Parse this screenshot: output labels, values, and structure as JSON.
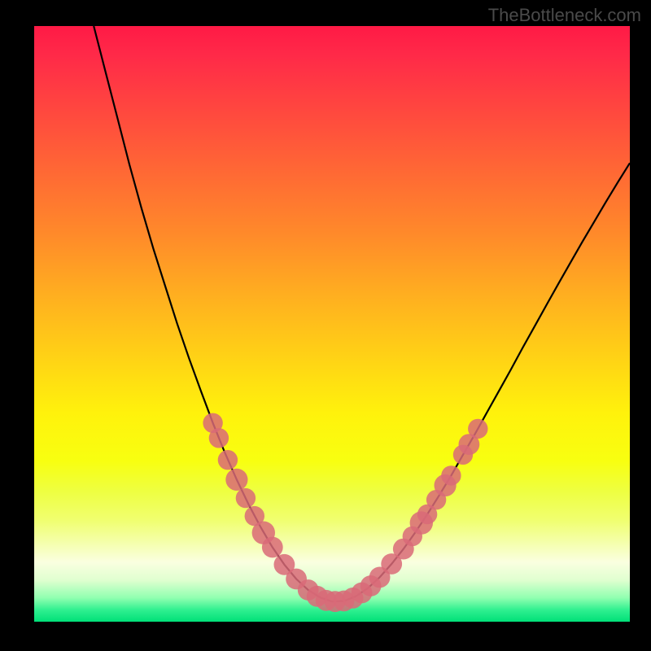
{
  "watermark": "TheBottleneck.com",
  "colors": {
    "background": "#000000",
    "curve": "#000000",
    "marker": "#d96a78",
    "gradient_top": "#ff1a46",
    "gradient_bottom": "#00e078"
  },
  "chart_data": {
    "type": "line",
    "title": "",
    "xlabel": "",
    "ylabel": "",
    "xlim": [
      0,
      100
    ],
    "ylim": [
      0,
      100
    ],
    "note": "V-shaped bottleneck curve. y is approximate bottleneck % (0 = green/good at bottom, 100 = red/bad at top). x is relative component-balance position.",
    "curve": [
      {
        "x": 10.0,
        "y": 100.0
      },
      {
        "x": 12.0,
        "y": 92.0
      },
      {
        "x": 14.0,
        "y": 84.0
      },
      {
        "x": 16.0,
        "y": 76.0
      },
      {
        "x": 18.0,
        "y": 68.5
      },
      {
        "x": 20.0,
        "y": 61.5
      },
      {
        "x": 22.0,
        "y": 55.0
      },
      {
        "x": 24.0,
        "y": 48.5
      },
      {
        "x": 26.0,
        "y": 42.5
      },
      {
        "x": 28.0,
        "y": 36.8
      },
      {
        "x": 30.0,
        "y": 31.3
      },
      {
        "x": 32.0,
        "y": 26.2
      },
      {
        "x": 34.0,
        "y": 21.5
      },
      {
        "x": 36.0,
        "y": 17.2
      },
      {
        "x": 38.0,
        "y": 13.3
      },
      {
        "x": 40.0,
        "y": 9.8
      },
      {
        "x": 42.0,
        "y": 6.8
      },
      {
        "x": 44.0,
        "y": 4.3
      },
      {
        "x": 46.0,
        "y": 2.4
      },
      {
        "x": 48.0,
        "y": 1.1
      },
      {
        "x": 50.0,
        "y": 0.4
      },
      {
        "x": 52.0,
        "y": 0.5
      },
      {
        "x": 54.0,
        "y": 1.3
      },
      {
        "x": 56.0,
        "y": 2.7
      },
      {
        "x": 58.0,
        "y": 4.6
      },
      {
        "x": 60.0,
        "y": 6.9
      },
      {
        "x": 62.0,
        "y": 9.5
      },
      {
        "x": 64.0,
        "y": 12.4
      },
      {
        "x": 66.0,
        "y": 15.5
      },
      {
        "x": 68.0,
        "y": 18.8
      },
      {
        "x": 70.0,
        "y": 22.2
      },
      {
        "x": 72.0,
        "y": 25.8
      },
      {
        "x": 74.0,
        "y": 29.4
      },
      {
        "x": 76.0,
        "y": 33.1
      },
      {
        "x": 78.0,
        "y": 36.8
      },
      {
        "x": 80.0,
        "y": 40.5
      },
      {
        "x": 82.0,
        "y": 44.3
      },
      {
        "x": 84.0,
        "y": 48.0
      },
      {
        "x": 86.0,
        "y": 51.7
      },
      {
        "x": 88.0,
        "y": 55.4
      },
      {
        "x": 90.0,
        "y": 59.0
      },
      {
        "x": 92.0,
        "y": 62.6
      },
      {
        "x": 94.0,
        "y": 66.1
      },
      {
        "x": 96.0,
        "y": 69.6
      },
      {
        "x": 98.0,
        "y": 73.0
      },
      {
        "x": 100.0,
        "y": 76.3
      }
    ],
    "markers": [
      {
        "x": 30.0,
        "y": 31.3,
        "r": 1.1
      },
      {
        "x": 31.0,
        "y": 28.7,
        "r": 1.1
      },
      {
        "x": 32.5,
        "y": 24.9,
        "r": 1.1
      },
      {
        "x": 34.0,
        "y": 21.5,
        "r": 1.3
      },
      {
        "x": 35.5,
        "y": 18.3,
        "r": 1.1
      },
      {
        "x": 37.0,
        "y": 15.2,
        "r": 1.1
      },
      {
        "x": 38.5,
        "y": 12.3,
        "r": 1.4
      },
      {
        "x": 40.0,
        "y": 9.8,
        "r": 1.2
      },
      {
        "x": 42.0,
        "y": 6.8,
        "r": 1.2
      },
      {
        "x": 44.0,
        "y": 4.3,
        "r": 1.2
      },
      {
        "x": 46.0,
        "y": 2.4,
        "r": 1.2
      },
      {
        "x": 47.5,
        "y": 1.3,
        "r": 1.2
      },
      {
        "x": 49.0,
        "y": 0.6,
        "r": 1.2
      },
      {
        "x": 50.5,
        "y": 0.4,
        "r": 1.2
      },
      {
        "x": 52.0,
        "y": 0.5,
        "r": 1.2
      },
      {
        "x": 53.5,
        "y": 1.0,
        "r": 1.2
      },
      {
        "x": 55.0,
        "y": 1.9,
        "r": 1.2
      },
      {
        "x": 56.5,
        "y": 3.1,
        "r": 1.2
      },
      {
        "x": 58.0,
        "y": 4.6,
        "r": 1.2
      },
      {
        "x": 60.0,
        "y": 6.9,
        "r": 1.2
      },
      {
        "x": 62.0,
        "y": 9.5,
        "r": 1.2
      },
      {
        "x": 63.5,
        "y": 11.7,
        "r": 1.1
      },
      {
        "x": 65.0,
        "y": 14.0,
        "r": 1.4
      },
      {
        "x": 66.0,
        "y": 15.5,
        "r": 1.1
      },
      {
        "x": 67.5,
        "y": 18.0,
        "r": 1.1
      },
      {
        "x": 69.0,
        "y": 20.5,
        "r": 1.3
      },
      {
        "x": 70.0,
        "y": 22.2,
        "r": 1.1
      },
      {
        "x": 72.0,
        "y": 25.8,
        "r": 1.1
      },
      {
        "x": 73.0,
        "y": 27.6,
        "r": 1.2
      },
      {
        "x": 74.5,
        "y": 30.3,
        "r": 1.1
      }
    ]
  }
}
